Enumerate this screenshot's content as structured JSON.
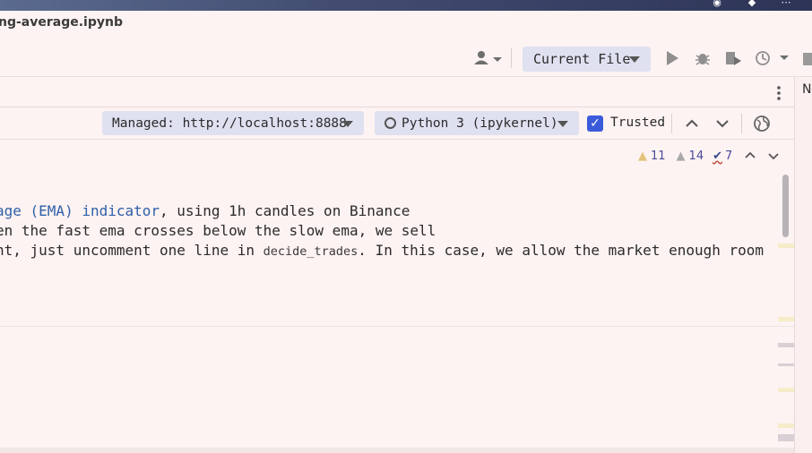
{
  "window": {
    "title": "ng-average.ipynb"
  },
  "toolbar": {
    "run_config": "Current File",
    "icons": [
      "user-icon",
      "run-icon",
      "debug-icon",
      "coverage-icon",
      "profile-icon",
      "stop-icon"
    ]
  },
  "right_strip": {
    "label": "No"
  },
  "notebook_toolbar": {
    "server": "Managed: http://localhost:8888",
    "kernel": "Python 3 (ipykernel)",
    "trusted_label": "Trusted",
    "trusted_checked": true
  },
  "inspections": {
    "warnings": "11",
    "weak_warnings": "14",
    "typos": "7"
  },
  "cell": {
    "line1_link": "age (EMA) indicator",
    "line1_rest": ", using 1h candles on Binance",
    "line2": "en the fast ema crosses below the slow ema, we sell",
    "line3_pre": "nt, just uncomment one line in ",
    "line3_code": "decide_trades",
    "line3_post": ". In this case, we allow the market enough room"
  },
  "colors": {
    "accent": "#3b5bdb",
    "link": "#2f5fa8",
    "background": "#fdf3f2",
    "pill": "#dfe1f1"
  }
}
